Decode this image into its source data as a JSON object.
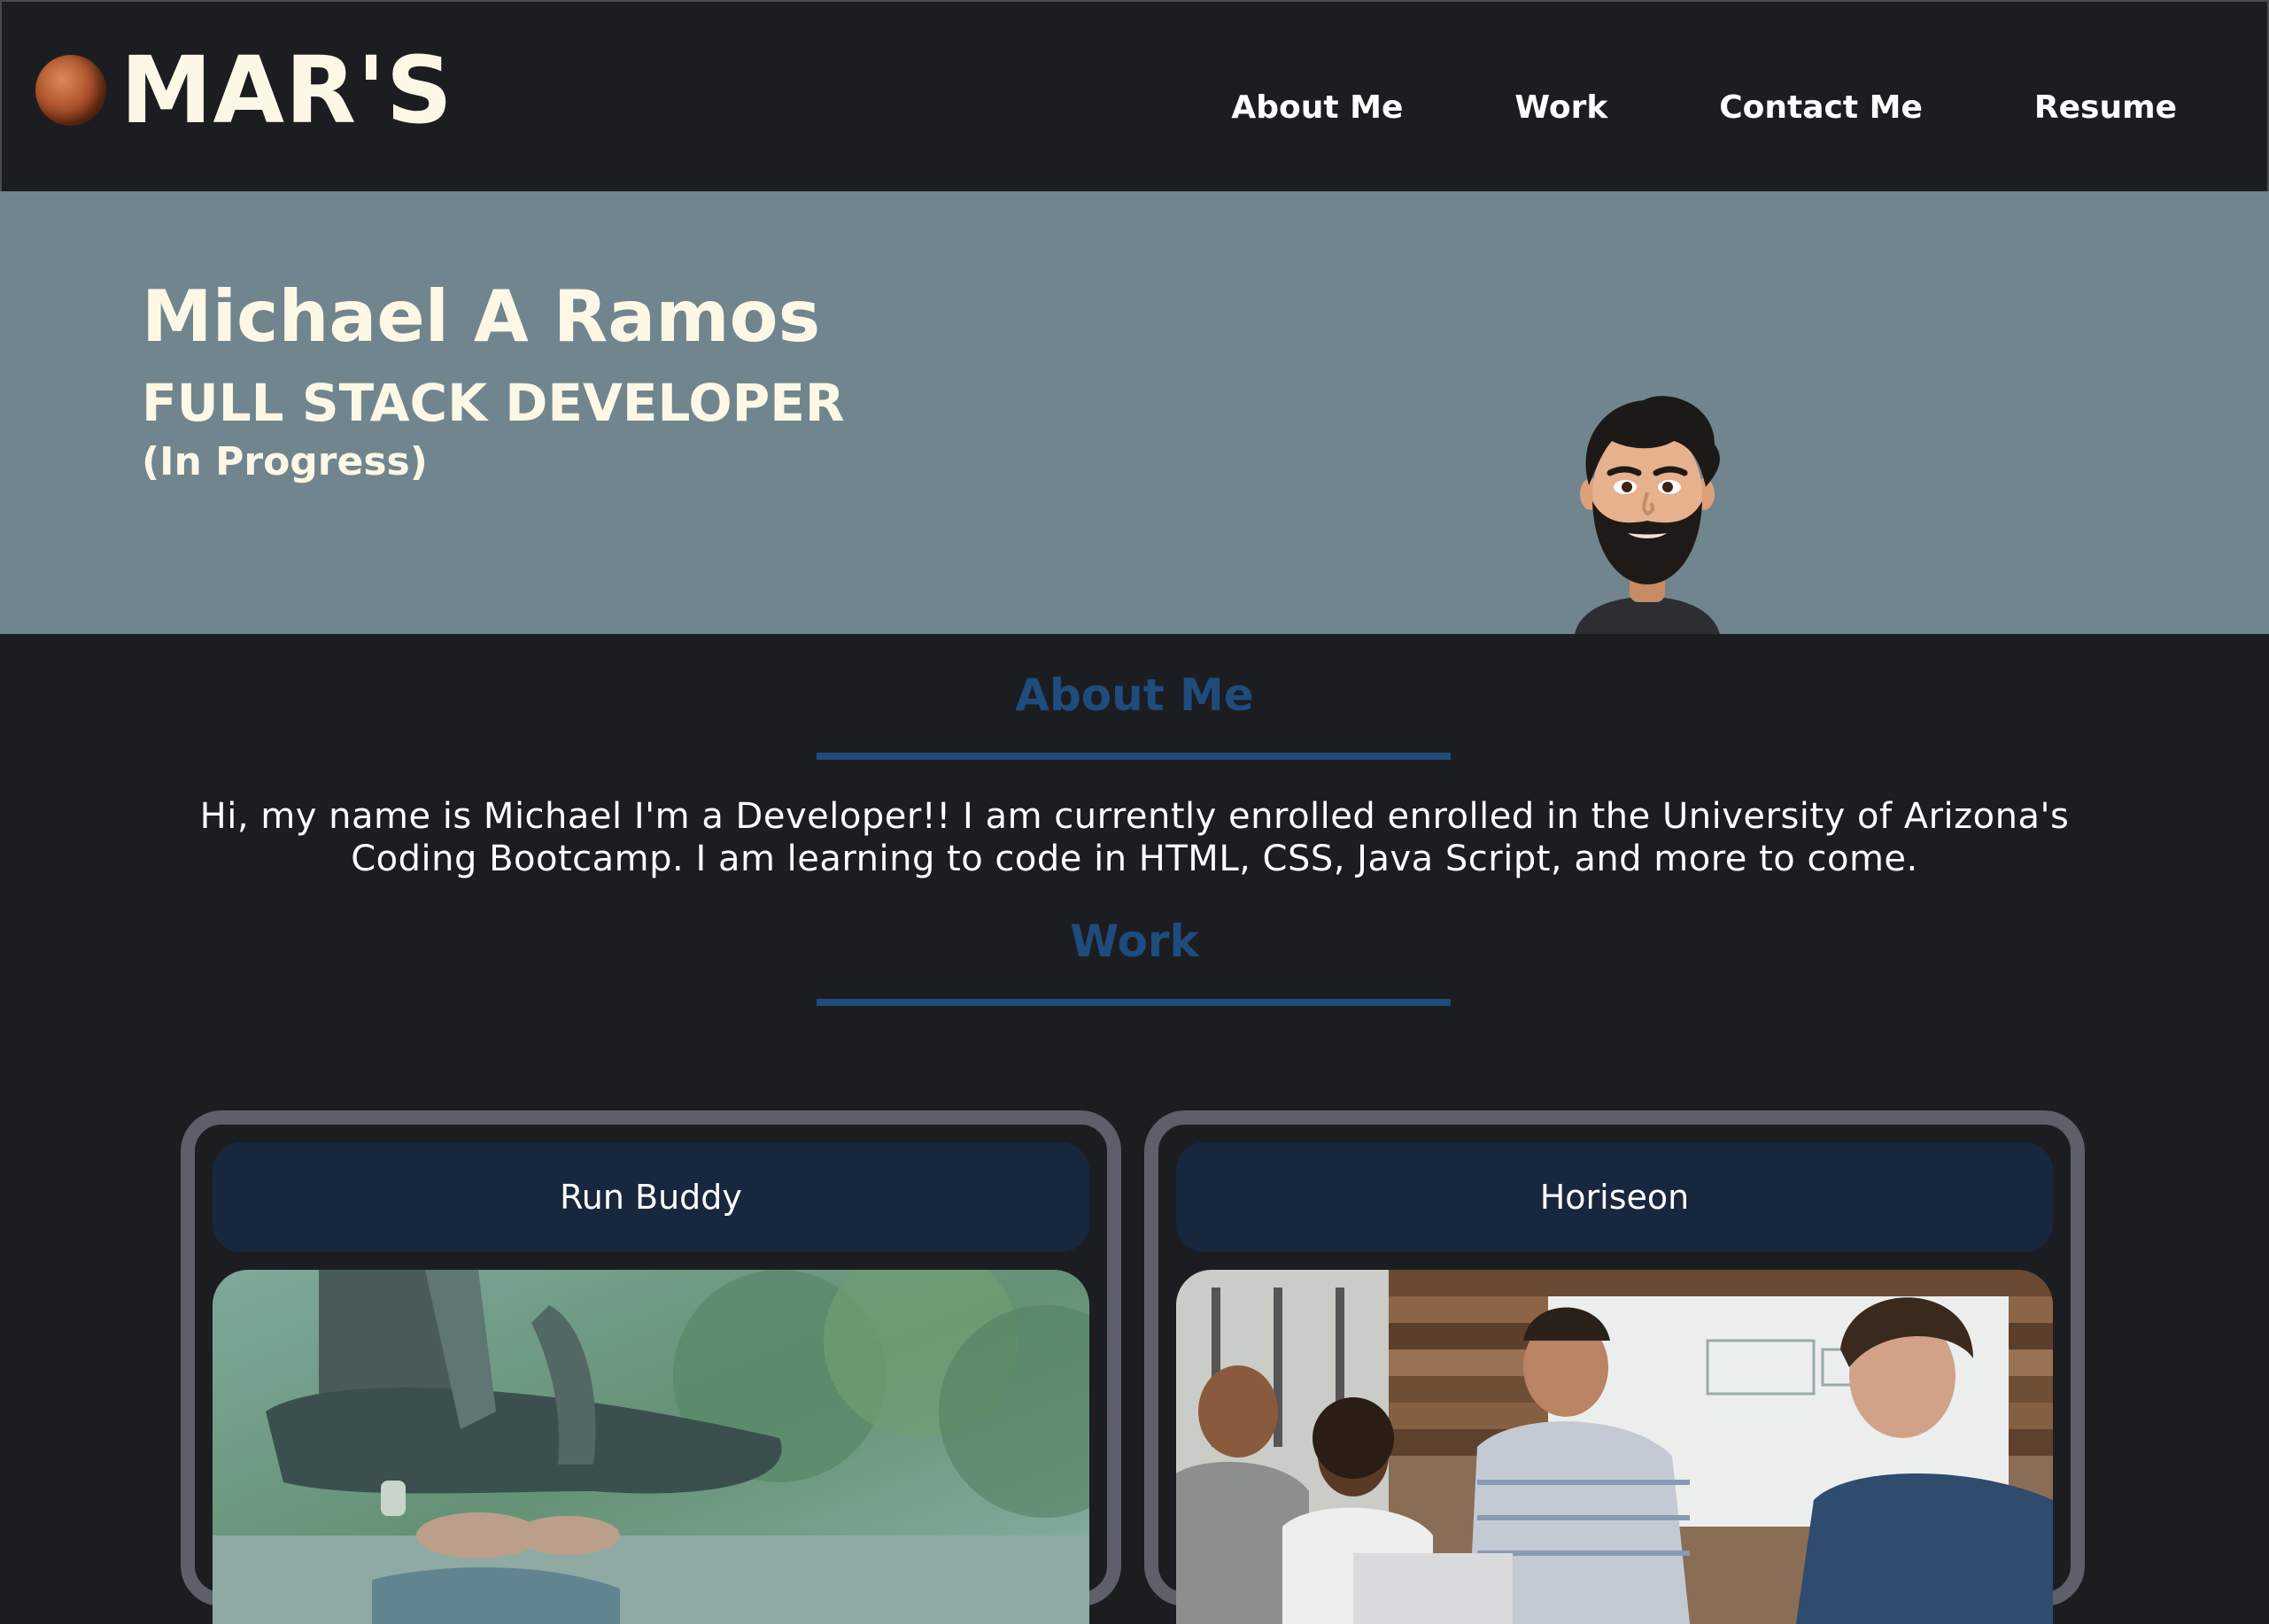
{
  "header": {
    "logo_text": "MAR'S",
    "logo_icon": "mars-planet-icon",
    "nav": [
      {
        "label": "About Me"
      },
      {
        "label": "Work"
      },
      {
        "label": "Contact Me"
      },
      {
        "label": "Resume"
      }
    ]
  },
  "hero": {
    "name": "Michael A Ramos",
    "role": "FULL STACK DEVELOPER",
    "status": "(In Progress)",
    "avatar": "bitmoji-avatar"
  },
  "about": {
    "title": "About Me",
    "text": "Hi, my name is Michael I'm a Developer!! I am currently enrolled enrolled in the University of Arizona's Coding Bootcamp. I am learning to code in HTML, CSS, Java Script, and more to come."
  },
  "work": {
    "title": "Work",
    "projects": [
      {
        "title": "Run Buddy",
        "image": "runner-tying-shoe-photo"
      },
      {
        "title": "Horiseon",
        "image": "team-meeting-photo"
      }
    ]
  },
  "colors": {
    "background": "#1c1d21",
    "hero": "#71858e",
    "accent": "#1e4c7d",
    "card_border": "#5d5f6b",
    "card_header": "#17273d",
    "headline_text": "#fdf8e6"
  }
}
